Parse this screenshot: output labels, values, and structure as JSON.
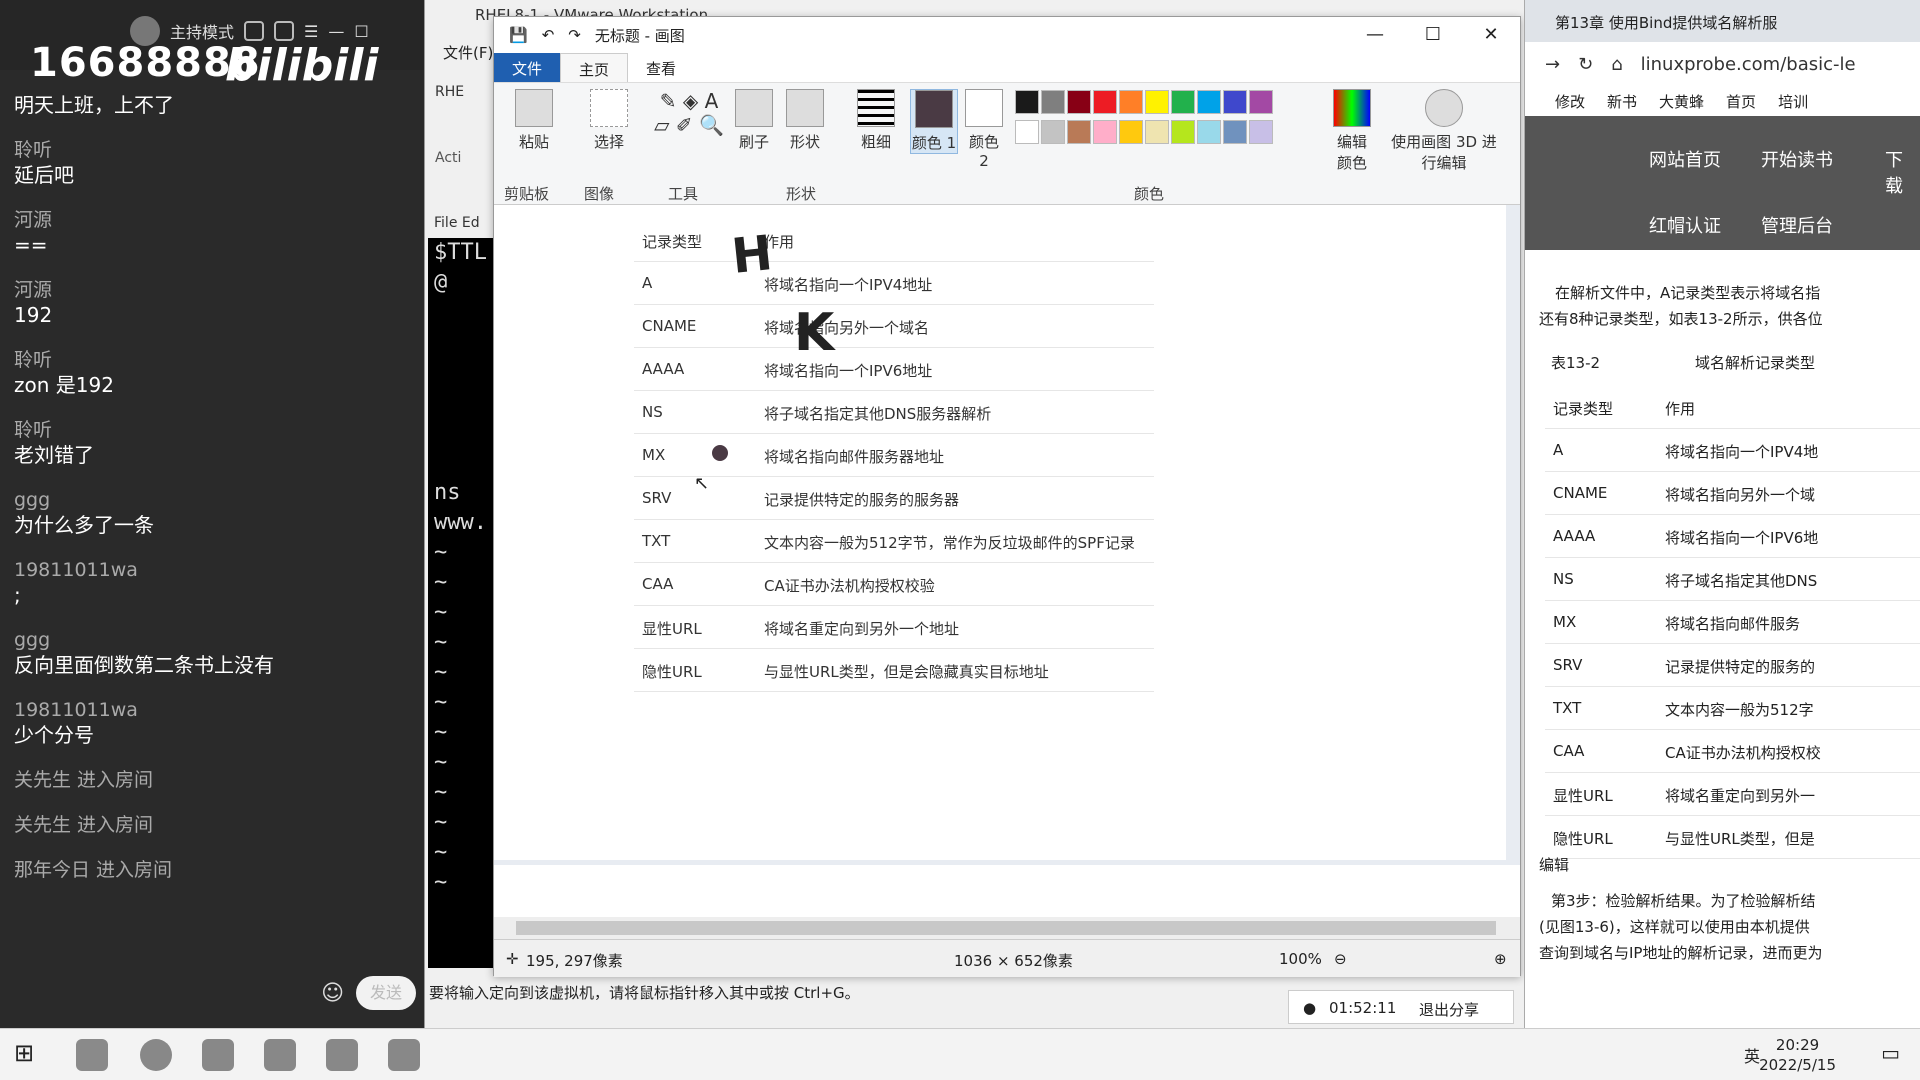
{
  "chat": {
    "host_mode": "主持模式",
    "phone": "16688888",
    "logo": "bilibili",
    "messages": [
      {
        "user": "",
        "text": "明天上班，上不了"
      },
      {
        "user": "聆听",
        "text": "延后吧"
      },
      {
        "user": "河源",
        "text": "=="
      },
      {
        "user": "河源",
        "text": "192"
      },
      {
        "user": "聆听",
        "text": "zon 是192"
      },
      {
        "user": "聆听",
        "text": "老刘错了"
      },
      {
        "user": "ggg",
        "text": "为什么多了一条"
      },
      {
        "user": "19811011wa",
        "text": ";"
      },
      {
        "user": "ggg",
        "text": "反向里面倒数第二条书上没有"
      },
      {
        "user": "19811011wa",
        "text": "少个分号"
      }
    ],
    "system": [
      "关先生 进入房间",
      "关先生 进入房间",
      "那年今日 进入房间"
    ],
    "send_label": "发送"
  },
  "vmware": {
    "title": "RHEL8-1 - VMware Workstation",
    "menu_file": "文件(F)",
    "tab_label": "RHE",
    "activities": "Acti",
    "editor_menu": "File  Ed",
    "terminal_lines": [
      "$TTL",
      "@",
      "",
      "",
      "",
      "",
      "",
      "",
      "ns",
      "www.",
      "~",
      "~",
      "~",
      "~",
      "~",
      "~",
      "~",
      "~",
      "~",
      "~",
      "~",
      "~"
    ],
    "status_message": "要将输入定向到该虚拟机，请将鼠标指针移入其中或按 Ctrl+G。"
  },
  "paint": {
    "title": "无标题 - 画图",
    "tabs": [
      "文件",
      "主页",
      "查看"
    ],
    "groups": {
      "clipboard": "剪贴板",
      "image": "图像",
      "tools": "工具",
      "shapes": "形状",
      "colors": "颜色"
    },
    "buttons": {
      "paste": "粘贴",
      "select": "选择",
      "brush": "刷子",
      "shape": "形状",
      "size": "粗细",
      "color1": "颜色 1",
      "color2": "颜色 2",
      "edit_colors": "编辑颜色",
      "paint3d": "使用画图 3D 进行编辑"
    },
    "table_header": {
      "type": "记录类型",
      "purpose": "作用"
    },
    "table_rows": [
      {
        "type": "A",
        "purpose": "将域名指向一个IPV4地址"
      },
      {
        "type": "CNAME",
        "purpose": "将域名指向另外一个域名"
      },
      {
        "type": "AAAA",
        "purpose": "将域名指向一个IPV6地址"
      },
      {
        "type": "NS",
        "purpose": "将子域名指定其他DNS服务器解析"
      },
      {
        "type": "MX",
        "purpose": "将域名指向邮件服务器地址"
      },
      {
        "type": "SRV",
        "purpose": "记录提供特定的服务的服务器"
      },
      {
        "type": "TXT",
        "purpose": "文本内容一般为512字节，常作为反垃圾邮件的SPF记录"
      },
      {
        "type": "CAA",
        "purpose": "CA证书办法机构授权校验"
      },
      {
        "type": "显性URL",
        "purpose": "将域名重定向到另外一个地址"
      },
      {
        "type": "隐性URL",
        "purpose": "与显性URL类型，但是会隐藏真实目标地址"
      }
    ],
    "status": {
      "cursor_pos": "195, 297像素",
      "canvas_size": "1036 × 652像素",
      "zoom": "100%"
    },
    "palette": [
      "#1a1a1a",
      "#7f7f7f",
      "#880015",
      "#ed1c24",
      "#ff7f27",
      "#fff200",
      "#22b14c",
      "#00a2e8",
      "#3f48cc",
      "#a349a4",
      "#ffffff",
      "#c3c3c3",
      "#b97a57",
      "#ffaec9",
      "#ffc90e",
      "#efe4b0",
      "#b5e61d",
      "#99d9ea",
      "#7092be",
      "#c8bfe7"
    ],
    "color1": "#4a3a44",
    "color2": "#ffffff"
  },
  "recording": {
    "time": "01:52:11",
    "exit_label": "退出分享"
  },
  "browser": {
    "tab_title": "第13章 使用Bind提供域名解析服",
    "url": "linuxprobe.com/basic-le",
    "bookmarks": [
      "修改",
      "新书",
      "大黄蜂",
      "首页",
      "培训"
    ],
    "nav": [
      "网站首页",
      "开始读书",
      "下载",
      "红帽认证",
      "管理后台"
    ],
    "para1": "在解析文件中，A记录类型表示将域名指",
    "para2": "还有8种记录类型，如表13-2所示，供各位",
    "table_caption": "表13-2",
    "table_title": "域名解析记录类型",
    "header": {
      "type": "记录类型",
      "purpose": "作用"
    },
    "rows": [
      {
        "type": "A",
        "purpose": "将域名指向一个IPV4地"
      },
      {
        "type": "CNAME",
        "purpose": "将域名指向另外一个域"
      },
      {
        "type": "AAAA",
        "purpose": "将域名指向一个IPV6地"
      },
      {
        "type": "NS",
        "purpose": "将子域名指定其他DNS"
      },
      {
        "type": "MX",
        "purpose": "将域名指向邮件服务"
      },
      {
        "type": "SRV",
        "purpose": "记录提供特定的服务的"
      },
      {
        "type": "TXT",
        "purpose": "文本内容一般为512字"
      },
      {
        "type": "CAA",
        "purpose": "CA证书办法机构授权校"
      },
      {
        "type": "显性URL",
        "purpose": "将域名重定向到另外一"
      },
      {
        "type": "隐性URL",
        "purpose": "与显性URL类型，但是"
      }
    ],
    "edit": "编辑",
    "step3": "第3步：检验解析结果。为了检验解析结",
    "step3b": "(见图13-6)，这样就可以使用由本机提供",
    "step3c": "查询到域名与IP地址的解析记录，进而更为"
  },
  "taskbar": {
    "time": "20:29",
    "date": "2022/5/15",
    "ime": "英"
  }
}
